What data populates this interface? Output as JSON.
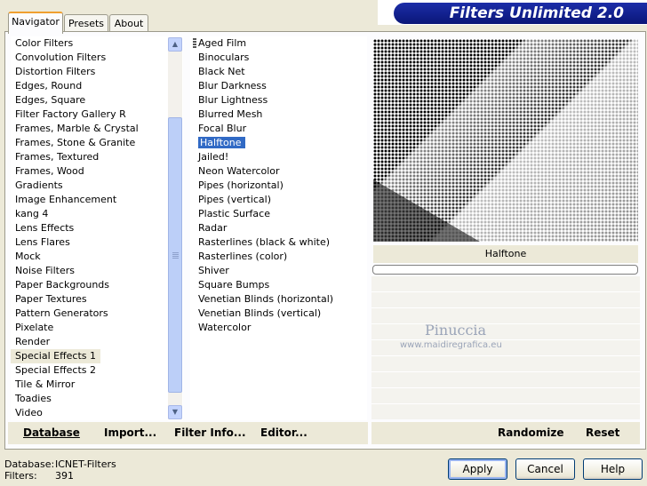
{
  "window": {
    "title": "Filters Unlimited 2.0"
  },
  "tabs": [
    {
      "label": "Navigator",
      "active": true
    },
    {
      "label": "Presets",
      "active": false
    },
    {
      "label": "About",
      "active": false
    }
  ],
  "categories": {
    "items": [
      "Color Filters",
      "Convolution Filters",
      "Distortion Filters",
      "Edges, Round",
      "Edges, Square",
      "Filter Factory Gallery R",
      "Frames, Marble & Crystal",
      "Frames, Stone & Granite",
      "Frames, Textured",
      "Frames, Wood",
      "Gradients",
      "Image Enhancement",
      "kang 4",
      "Lens Effects",
      "Lens Flares",
      "Mock",
      "Noise Filters",
      "Paper Backgrounds",
      "Paper Textures",
      "Pattern Generators",
      "Pixelate",
      "Render",
      "Special Effects 1",
      "Special Effects 2",
      "Tile & Mirror",
      "Toadies",
      "Video"
    ],
    "selected": "Special Effects 1"
  },
  "filters": {
    "items": [
      "Aged Film",
      "Binoculars",
      "Black Net",
      "Blur Darkness",
      "Blur Lightness",
      "Blurred Mesh",
      "Focal Blur",
      "Halftone",
      "Jailed!",
      "Neon Watercolor",
      "Pipes (horizontal)",
      "Pipes (vertical)",
      "Plastic Surface",
      "Radar",
      "Rasterlines (black & white)",
      "Rasterlines (color)",
      "Shiver",
      "Square Bumps",
      "Venetian Blinds (horizontal)",
      "Venetian Blinds (vertical)",
      "Watercolor"
    ],
    "selected": "Halftone"
  },
  "preview": {
    "filter_name": "Halftone",
    "progress": 0
  },
  "watermark": {
    "name": "Pinuccia",
    "site": "www.maidiregrafica.eu"
  },
  "toolbar": {
    "database": "Database",
    "import": "Import...",
    "filter_info": "Filter Info...",
    "editor": "Editor...",
    "randomize": "Randomize",
    "reset": "Reset"
  },
  "status": {
    "database_label": "Database:",
    "database_value": "ICNET-Filters",
    "filters_label": "Filters:",
    "filters_value": "391"
  },
  "buttons": {
    "apply": "Apply",
    "cancel": "Cancel",
    "help": "Help"
  },
  "colors": {
    "title_bar": "#0a1678",
    "selection": "#316ac5",
    "dialog_bg": "#ece9d8"
  }
}
